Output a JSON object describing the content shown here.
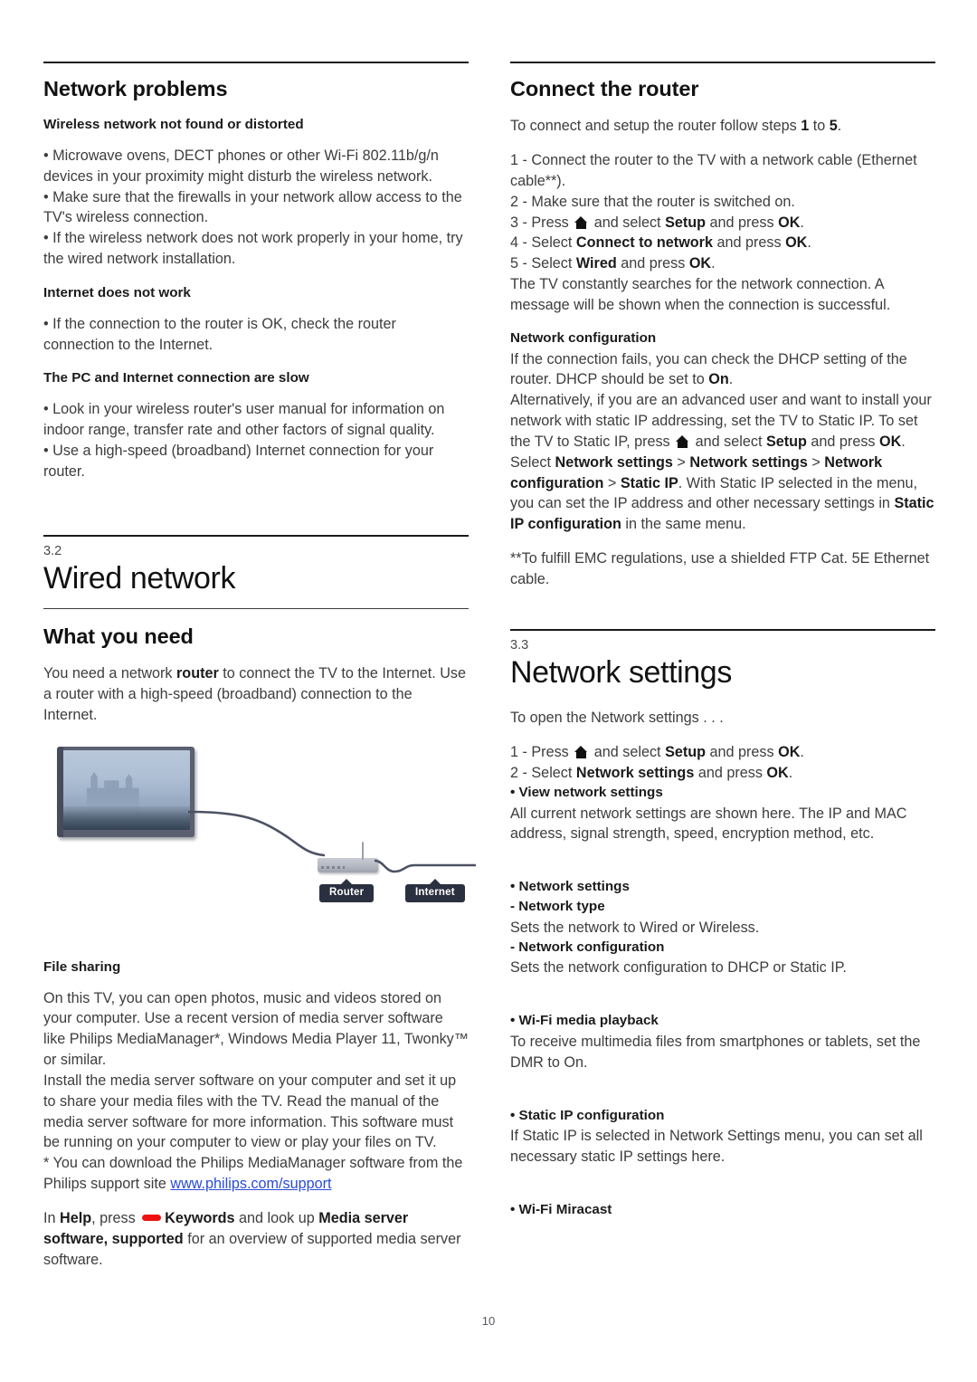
{
  "page": {
    "number": "10"
  },
  "left_column": {
    "network_problems": {
      "title": "Network problems",
      "sub1": "Wireless network not found or distorted",
      "bullets1": [
        "• Microwave ovens, DECT phones or other Wi-Fi 802.11b/g/n devices in your proximity might disturb the wireless network.",
        "• Make sure that the firewalls in your network allow access to the TV's wireless connection.",
        "• If the wireless network does not work properly in your home, try the wired network installation."
      ],
      "sub2": "Internet does not work",
      "bullets2": [
        "• If the connection to the router is OK, check the router connection to the Internet."
      ],
      "sub3": "The PC and Internet connection are slow",
      "bullets3": [
        "• Look in your wireless router's user manual for information on indoor range, transfer rate and other factors of signal quality.",
        "• Use a high-speed (broadband) Internet connection for your router."
      ]
    },
    "wired_network": {
      "section_number": "3.2",
      "section_title": "Wired network",
      "what_you_need_heading": "What you need",
      "what_you_need_body_pre": "You need a network ",
      "what_you_need_body_bold": "router",
      "what_you_need_body_post": " to connect the TV to the Internet. Use a router with a high-speed (broadband) connection to the Internet."
    },
    "figure": {
      "tag_router": "Router",
      "tag_internet": "Internet"
    },
    "file_sharing": {
      "heading": "File sharing",
      "para1": "On this TV, you can open photos, music and videos stored on your computer. Use a recent version of media server software like Philips MediaManager*, Windows Media Player 11, Twonky™ or similar.",
      "para2": "Install the media server software on your computer and set it up to share your media files with the TV. Read the manual of the media server software for more information. This software must be running on your computer to view or play your files on TV.",
      "para3_pre": "* You can download the Philips MediaManager software from the Philips support site ",
      "para3_link": "www.philips.com/support",
      "help_line": {
        "pre": "In ",
        "b1": "Help",
        "mid1": ", press ",
        "key_icon": "red-key-icon",
        "b2": "Keywords",
        "mid2": " and look up ",
        "b3": "Media server software, supported",
        "post": " for an overview of supported media server software."
      }
    }
  },
  "right_column": {
    "connect_router": {
      "title": "Connect the router",
      "intro_pre": "To connect and setup the router follow steps ",
      "intro_b1": "1",
      "intro_mid": " to ",
      "intro_b2": "5",
      "intro_post": ".",
      "steps": [
        "1 - Connect the router to the TV with a network cable (Ethernet cable**).",
        "2 - Make sure that the router is switched on."
      ],
      "step3_pre": "3 - Press ",
      "step3_icon": "home-icon",
      "step3_mid": " and select ",
      "step3_b1": "Setup",
      "step3_mid2": " and press ",
      "step3_b2": "OK",
      "step3_post": ".",
      "step4_pre": "4 - Select ",
      "step4_b1": "Connect to network",
      "step4_mid": " and press ",
      "step4_b2": "OK",
      "step4_post": ".",
      "step5_pre": "5 - Select ",
      "step5_b1": "Wired",
      "step5_mid": " and press ",
      "step5_b2": "OK",
      "step5_post": ".",
      "tail": "The TV constantly searches for the network connection. A message will be shown when the connection is successful."
    },
    "network_configuration": {
      "heading": "Network configuration",
      "line1_pre": "If the connection fails, you can check the DHCP setting of the router. DHCP should be set to ",
      "line1_b": "On",
      "line1_post": ".",
      "line2_pre": "Alternatively, if you are an advanced user and want to install your network with static IP addressing, set the TV to Static IP. To set the TV to Static IP, press ",
      "line2_icon": "home-icon",
      "line2_mid": " and select ",
      "line2_b1": "Setup",
      "line2_mid2": " and press ",
      "line2_b2": "OK",
      "line2_post": ".",
      "line3_pre": "Select ",
      "line3_b1": "Network settings",
      "line3_sep1": " > ",
      "line3_b2": "Network settings",
      "line3_sep2": " > ",
      "line3_b3": "Network configuration",
      "line3_sep3": " > ",
      "line3_b4": "Static IP",
      "line3_mid": ". With Static IP selected in the menu, you can set the IP address and other necessary settings in ",
      "line3_b5": "Static IP configuration",
      "line3_post": " in the same menu.",
      "footnote": "**To fulfill EMC regulations, use a shielded FTP Cat. 5E Ethernet cable."
    },
    "network_settings": {
      "section_number": "3.3",
      "section_title": "Network settings",
      "intro": "To open the Network settings . . .",
      "step1_pre": "1 - Press ",
      "step1_icon": "home-icon",
      "step1_mid": " and select ",
      "step1_b1": "Setup",
      "step1_mid2": " and press ",
      "step1_b2": "OK",
      "step1_post": ".",
      "step2_pre": "2 - Select ",
      "step2_b1": "Network settings",
      "step2_mid": " and press ",
      "step2_b2": "OK",
      "step2_post": ".",
      "bullet_view": "• View network settings",
      "view_body": "All current network settings are shown here. The IP and MAC address, signal strength, speed, encryption method, etc.",
      "bullet_settings": "• Network settings",
      "sub_network_type": "- Network type",
      "network_type_body": "Sets the network to Wired or Wireless.",
      "sub_network_config": "- Network configuration",
      "network_config_body": "Sets the network configuration to DHCP or Static IP.",
      "bullet_wifi_media": "• Wi-Fi media playback",
      "wifi_media_body": "To receive multimedia files from smartphones or tablets, set the DMR to On.",
      "bullet_static_ip": "• Static IP configuration",
      "static_ip_body": "If Static IP is selected in Network Settings menu, you can set all necessary static IP settings here.",
      "bullet_miracast": "• Wi-Fi Miracast"
    }
  },
  "colors": {
    "link": "#2a4bd8",
    "red_key": "#ee1111",
    "tag_bg": "#2b3040",
    "rule": "#1a1a1a"
  }
}
